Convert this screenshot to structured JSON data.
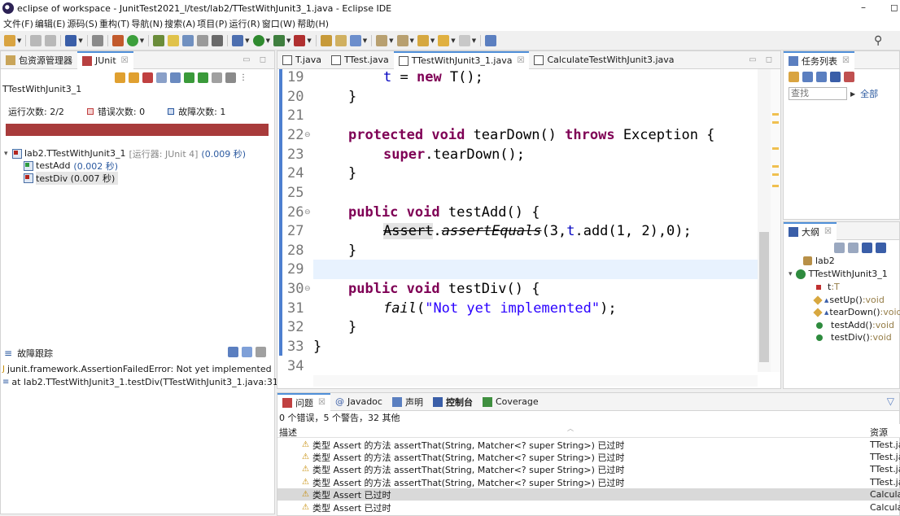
{
  "window": {
    "title": "eclipse of workspace - JunitTest2021_l/test/lab2/TTestWithJunit3_1.java - Eclipse IDE",
    "minimize_glyph": "–",
    "restore_glyph": "◻"
  },
  "menu": [
    "文件(F)",
    "编辑(E)",
    "源码(S)",
    "重构(T)",
    "导航(N)",
    "搜索(A)",
    "项目(P)",
    "运行(R)",
    "窗口(W)",
    "帮助(H)"
  ],
  "toolbar_icons": [
    "new-icon",
    "save-icon",
    "save-all-icon",
    "terminal-icon",
    "skip-icon",
    "debug-icon",
    "coverage-icon",
    "run-icon",
    "external-tools-icon",
    "search-icon"
  ],
  "junit_panel": {
    "tabs": [
      {
        "label": "包资源管理器",
        "active": false
      },
      {
        "label": "JUnit",
        "active": true,
        "close": "☒"
      }
    ],
    "test_class": "TTestWithJunit3_1",
    "runs_label": "运行次数:",
    "runs_value": "2/2",
    "errors_label": "错误次数:",
    "errors_value": "0",
    "failures_label": "故障次数:",
    "failures_value": "1",
    "bar_color": "#a83b3b",
    "tree_root": {
      "name": "lab2.TTestWithJunit3_1",
      "runner": "[运行器: JUnit 4]",
      "time": "(0.009 秒)"
    },
    "tree_children": [
      {
        "name": "testAdd",
        "time": "(0.002 秒)",
        "status": "ok"
      },
      {
        "name": "testDiv",
        "time": "(0.007 秒)",
        "status": "failed"
      }
    ],
    "failure_trace_title": "故障跟踪",
    "trace_lines": [
      "junit.framework.AssertionFailedError: Not yet implemented",
      "at lab2.TTestWithJunit3_1.testDiv(TTestWithJunit3_1.java:31)"
    ]
  },
  "editor": {
    "tabs": [
      {
        "label": "T.java",
        "active": false
      },
      {
        "label": "TTest.java",
        "active": false
      },
      {
        "label": "TTestWithJunit3_1.java",
        "active": true,
        "close": "☒"
      },
      {
        "label": "CalculateTestWithJunit3.java",
        "active": false
      }
    ],
    "line_numbers": [
      "19",
      "20",
      "21",
      "22",
      "23",
      "24",
      "25",
      "26",
      "27",
      "28",
      "29",
      "30",
      "31",
      "32",
      "33",
      "34"
    ],
    "code": {
      "l19_var": "t",
      "l19_rest": " = ",
      "l19_new": "new",
      "l19_end": " T();",
      "l20": "}",
      "l22_protected": "protected",
      "l22_void": "void",
      "l22_name": " tearDown() ",
      "l22_throws": "throws",
      "l22_end": " Exception {",
      "l23_super": "super",
      "l23_end": ".tearDown();",
      "l24": "}",
      "l26_public": "public",
      "l26_void": "void",
      "l26_end": " testAdd() {",
      "l27_assert": "Assert",
      "l27_dot": ".",
      "l27_method": "assertEquals",
      "l27_args1": "(3,",
      "l27_t": "t",
      "l27_args2": ".add(1, 2),0);",
      "l28": "}",
      "l30_public": "public",
      "l30_void": "void",
      "l30_end": " testDiv() {",
      "l31_fail": "fail",
      "l31_open": "(",
      "l31_str": "\"Not yet implemented\"",
      "l31_close": ");",
      "l32": "}",
      "l33": "}"
    }
  },
  "task_list": {
    "title": "任务列表",
    "close": "☒",
    "search_placeholder": "查找",
    "all_label": "全部"
  },
  "outline": {
    "title": "大纲",
    "close": "☒",
    "package": "lab2",
    "class_name": "TTestWithJunit3_1",
    "members": [
      {
        "name": "t",
        "sep": " : ",
        "type": "T",
        "icon": "field-private-icon"
      },
      {
        "name": "setUp()",
        "sep": " : ",
        "type": "void",
        "icon": "method-protected-icon"
      },
      {
        "name": "tearDown()",
        "sep": " : ",
        "type": "void",
        "icon": "method-protected-icon"
      },
      {
        "name": "testAdd()",
        "sep": " : ",
        "type": "void",
        "icon": "method-public-icon"
      },
      {
        "name": "testDiv()",
        "sep": " : ",
        "type": "void",
        "icon": "method-public-icon"
      }
    ]
  },
  "bottom_panel": {
    "tabs": [
      {
        "label": "问题",
        "active": true,
        "close": "☒"
      },
      {
        "label": "Javadoc",
        "active": false
      },
      {
        "label": "声明",
        "active": false
      },
      {
        "label": "控制台",
        "active": false
      },
      {
        "label": "Coverage",
        "active": false
      }
    ],
    "summary": "0 个错误，5 个警告，32 其他",
    "col_description": "描述",
    "col_resource": "资源",
    "rows": [
      {
        "text": "类型 Assert 的方法 assertThat(String, Matcher<? super String>) 已过时",
        "resource": "TTest.ja"
      },
      {
        "text": "类型 Assert 的方法 assertThat(String, Matcher<? super String>) 已过时",
        "resource": "TTest.ja"
      },
      {
        "text": "类型 Assert 的方法 assertThat(String, Matcher<? super String>) 已过时",
        "resource": "TTest.ja"
      },
      {
        "text": "类型 Assert 的方法 assertThat(String, Matcher<? super String>) 已过时",
        "resource": "TTest.ja"
      },
      {
        "text": "类型 Assert 已过时",
        "resource": "Calcula"
      },
      {
        "text": "类型 Assert 已过时",
        "resource": "Calcula"
      }
    ]
  }
}
